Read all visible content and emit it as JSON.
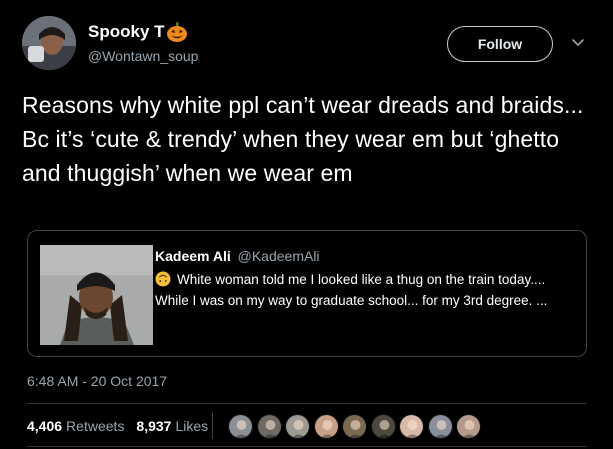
{
  "tweet": {
    "display_name": "Spooky T",
    "name_emoji_icon": "jack-o-lantern-icon",
    "handle": "@Wontawn_soup",
    "follow_label": "Follow",
    "text": "Reasons why white ppl can’t wear dreads and braids... Bc it’s ‘cute & trendy’ when they wear em but ‘ghetto and thuggish’ when we wear em",
    "timestamp": "6:48 AM - 20 Oct 2017"
  },
  "quoted_tweet": {
    "display_name": "Kadeem Ali",
    "handle": "@KadeemAli",
    "emoji_icon": "upside-down-face-icon",
    "text": "White woman told me I looked like a thug on the train today.... While I was on my way to graduate school... for my 3rd degree. ..."
  },
  "stats": {
    "retweets_count": "4,406",
    "retweets_label": "Retweets",
    "likes_count": "8,937",
    "likes_label": "Likes"
  },
  "likers": [
    {
      "color": "#8b8f96"
    },
    {
      "color": "#6d6a63"
    },
    {
      "color": "#9c9a93"
    },
    {
      "color": "#c7a088"
    },
    {
      "color": "#7a6a52"
    },
    {
      "color": "#4c4a3e"
    },
    {
      "color": "#d8b8a8"
    },
    {
      "color": "#8a8f9a"
    },
    {
      "color": "#b39a8c"
    }
  ],
  "colors": {
    "background": "#000000",
    "secondary_text": "#9aa4ad",
    "border": "#3d4247"
  }
}
